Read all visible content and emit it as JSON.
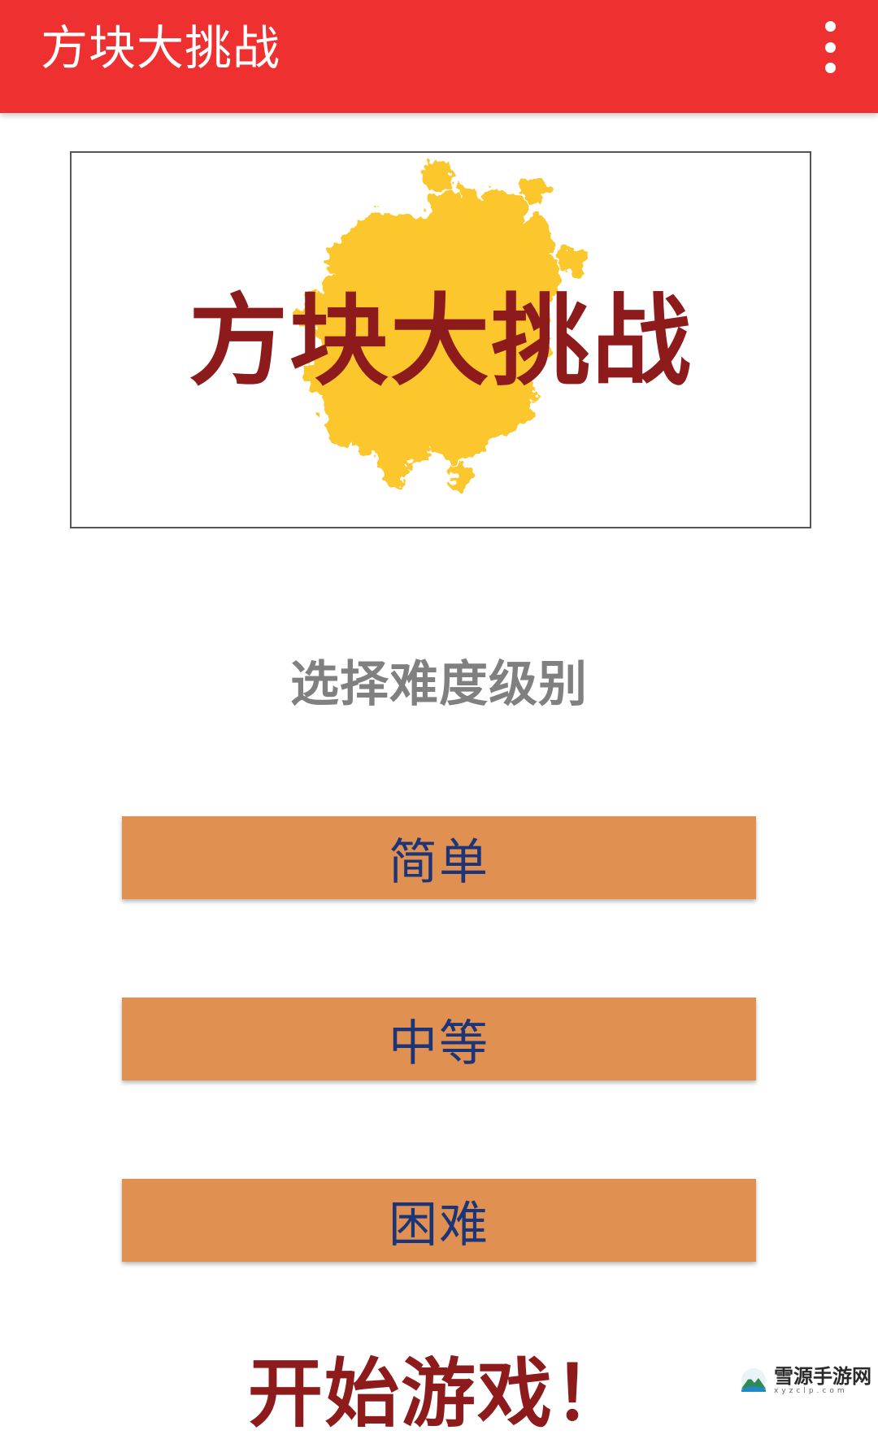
{
  "app_bar": {
    "title": "方块大挑战",
    "menu_icon": "overflow-menu-icon",
    "background": "#ee3030"
  },
  "banner": {
    "title": "方块大挑战",
    "splash_color": "#fbc520",
    "title_color": "#8e1b1b"
  },
  "difficulty": {
    "prompt": "选择难度级别",
    "options": [
      {
        "label": "简单"
      },
      {
        "label": "中等"
      },
      {
        "label": "困难"
      }
    ],
    "button_color": "#e09050",
    "text_color": "#1c3478"
  },
  "start_button": {
    "label": "开始游戏！"
  },
  "watermark": {
    "name": "雪源手游网",
    "url": "xyzclp.com",
    "icon": "mountain-logo-icon"
  }
}
